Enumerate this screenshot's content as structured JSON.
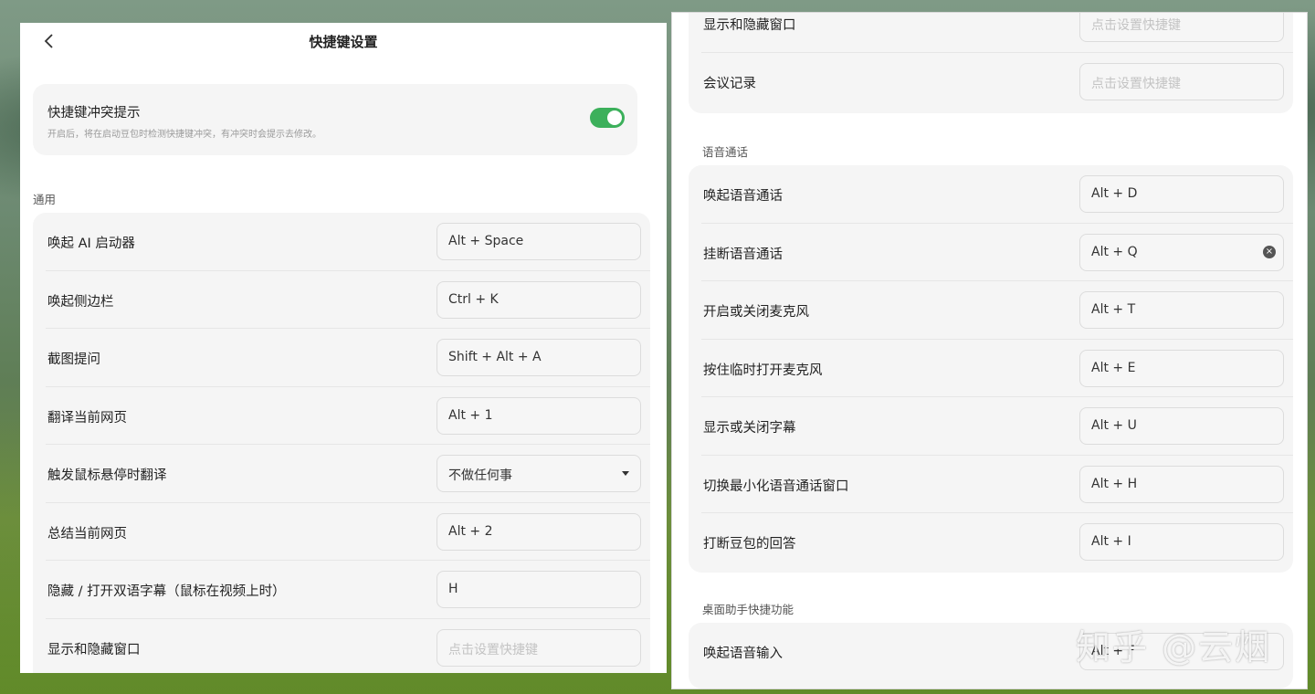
{
  "left": {
    "title": "快捷键设置",
    "conflict": {
      "title": "快捷键冲突提示",
      "desc": "开启后，将在启动豆包时检测快捷键冲突，有冲突时会提示去修改。",
      "enabled": true
    },
    "section_general": "通用",
    "rows": [
      {
        "label": "唤起 AI 启动器",
        "value": "Alt + Space"
      },
      {
        "label": "唤起侧边栏",
        "value": "Ctrl + K"
      },
      {
        "label": "截图提问",
        "value": "Shift + Alt + A"
      },
      {
        "label": "翻译当前网页",
        "value": "Alt + 1"
      },
      {
        "label": "触发鼠标悬停时翻译",
        "value": "不做任何事"
      },
      {
        "label": "总结当前网页",
        "value": "Alt + 2"
      },
      {
        "label": "隐藏 / 打开双语字幕（鼠标在视频上时）",
        "value": "H"
      },
      {
        "label": "显示和隐藏窗口",
        "placeholder": "点击设置快捷键"
      }
    ]
  },
  "right": {
    "top_rows": [
      {
        "label": "显示和隐藏窗口",
        "placeholder": "点击设置快捷键"
      },
      {
        "label": "会议记录",
        "placeholder": "点击设置快捷键"
      }
    ],
    "section_voice": "语音通话",
    "voice_rows": [
      {
        "label": "唤起语音通话",
        "value": "Alt + D"
      },
      {
        "label": "挂断语音通话",
        "value": "Alt + Q"
      },
      {
        "label": "开启或关闭麦克风",
        "value": "Alt + T"
      },
      {
        "label": "按住临时打开麦克风",
        "value": "Alt + E"
      },
      {
        "label": "显示或关闭字幕",
        "value": "Alt + U"
      },
      {
        "label": "切换最小化语音通话窗口",
        "value": "Alt + H"
      },
      {
        "label": "打断豆包的回答",
        "value": "Alt + I"
      }
    ],
    "section_desktop": "桌面助手快捷功能",
    "desktop_rows": [
      {
        "label": "唤起语音输入",
        "value": "Alt + F"
      }
    ]
  },
  "watermark": "知乎 @云烟",
  "colors": {
    "toggle_on": "#3cb05b",
    "card_bg": "#f5f5f5",
    "field_bg": "#f6f6f6"
  },
  "icons": {
    "back": "chevron-left-icon",
    "dropdown": "caret-down-icon",
    "clear": "clear-circle-icon"
  }
}
